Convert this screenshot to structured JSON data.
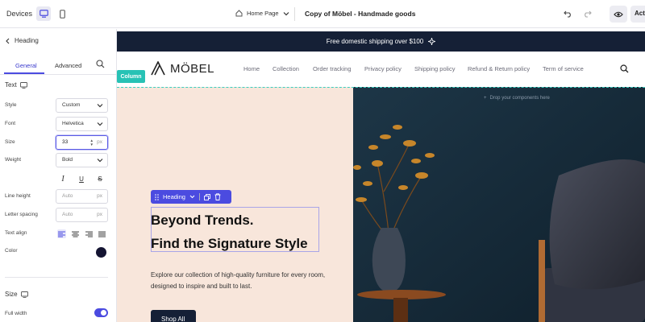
{
  "topbar": {
    "devices_label": "Devices",
    "page_name": "Home Page",
    "doc_title": "Copy of Möbel - Handmade goods",
    "publish_label": "Act",
    "icons": [
      "desktop-icon",
      "mobile-icon",
      "home-icon",
      "chevron-down-icon",
      "undo-icon",
      "redo-icon",
      "eye-icon"
    ]
  },
  "panel": {
    "back_label": "Heading",
    "tabs": [
      "General",
      "Advanced"
    ],
    "text_section": "Text",
    "style": {
      "label": "Style",
      "value": "Custom"
    },
    "font": {
      "label": "Font",
      "value": "Helvetica"
    },
    "size": {
      "label": "Size",
      "value": "33",
      "unit": "px"
    },
    "weight": {
      "label": "Weight",
      "value": "Bold"
    },
    "format_icons": [
      "I",
      "U",
      "S"
    ],
    "line_height": {
      "label": "Line height",
      "placeholder": "Auto",
      "unit": "px"
    },
    "letter_spacing": {
      "label": "Letter spacing",
      "placeholder": "Auto",
      "unit": "px"
    },
    "text_align": {
      "label": "Text align"
    },
    "color": {
      "label": "Color",
      "value": "#141432"
    },
    "size_section": "Size",
    "full_width": {
      "label": "Full width",
      "on": true
    }
  },
  "canvas": {
    "announcement": "Free domestic shipping over $100",
    "logo": "MÖBEL",
    "nav": [
      "Home",
      "Collection",
      "Order tracking",
      "Privacy policy",
      "Shipping policy",
      "Refund & Return policy",
      "Term of service"
    ],
    "column_badge": "Column",
    "drop_hint": "Drop your components here",
    "heading_toolbar_label": "Heading",
    "heading_line1": "Beyond Trends.",
    "heading_line2": "Find the Signature Style",
    "description": "Explore our collection of high-quality furniture for every room, designed to inspire and built to last.",
    "cta": "Shop All"
  },
  "colors": {
    "accent": "#4b4be0",
    "announcement_bg": "#152036",
    "hero_left_bg": "#f8e6db",
    "column_badge": "#27c2b5"
  }
}
